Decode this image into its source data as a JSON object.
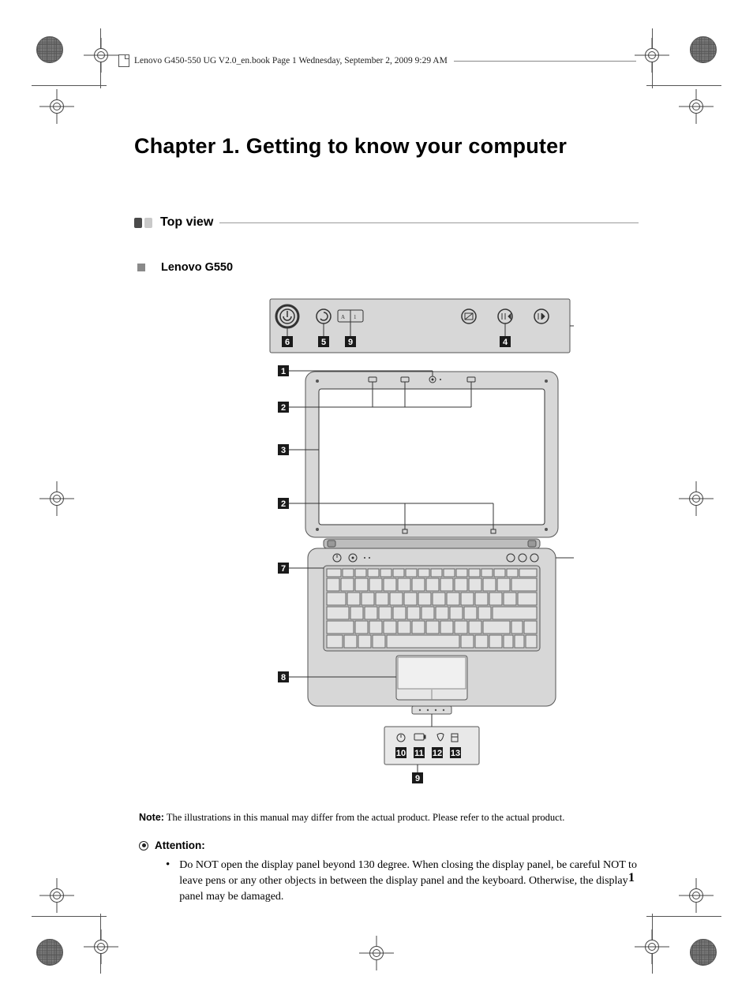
{
  "header": {
    "running_text": "Lenovo G450-550 UG V2.0_en.book  Page 1  Wednesday, September 2, 2009  9:29 AM"
  },
  "chapter": {
    "title": "Chapter 1. Getting to know your computer"
  },
  "section": {
    "title": "Top view"
  },
  "subsection": {
    "title": "Lenovo G550"
  },
  "diagram": {
    "callouts": {
      "top_row": [
        "6",
        "5",
        "9",
        "4"
      ],
      "left_side": [
        "1",
        "2",
        "3",
        "2",
        "7",
        "8"
      ],
      "bottom_leds": [
        "10",
        "11",
        "12",
        "13"
      ],
      "bottom_center": "9"
    }
  },
  "note": {
    "label": "Note:",
    "text": "The illustrations in this manual may differ from the actual product. Please refer to the actual product."
  },
  "attention": {
    "label": "Attention:",
    "bullets": [
      "Do NOT open the display panel beyond 130 degree. When closing the display panel, be careful NOT to leave pens or any other objects in between the display panel and the keyboard. Otherwise, the display panel may be damaged."
    ]
  },
  "page_number": "1"
}
